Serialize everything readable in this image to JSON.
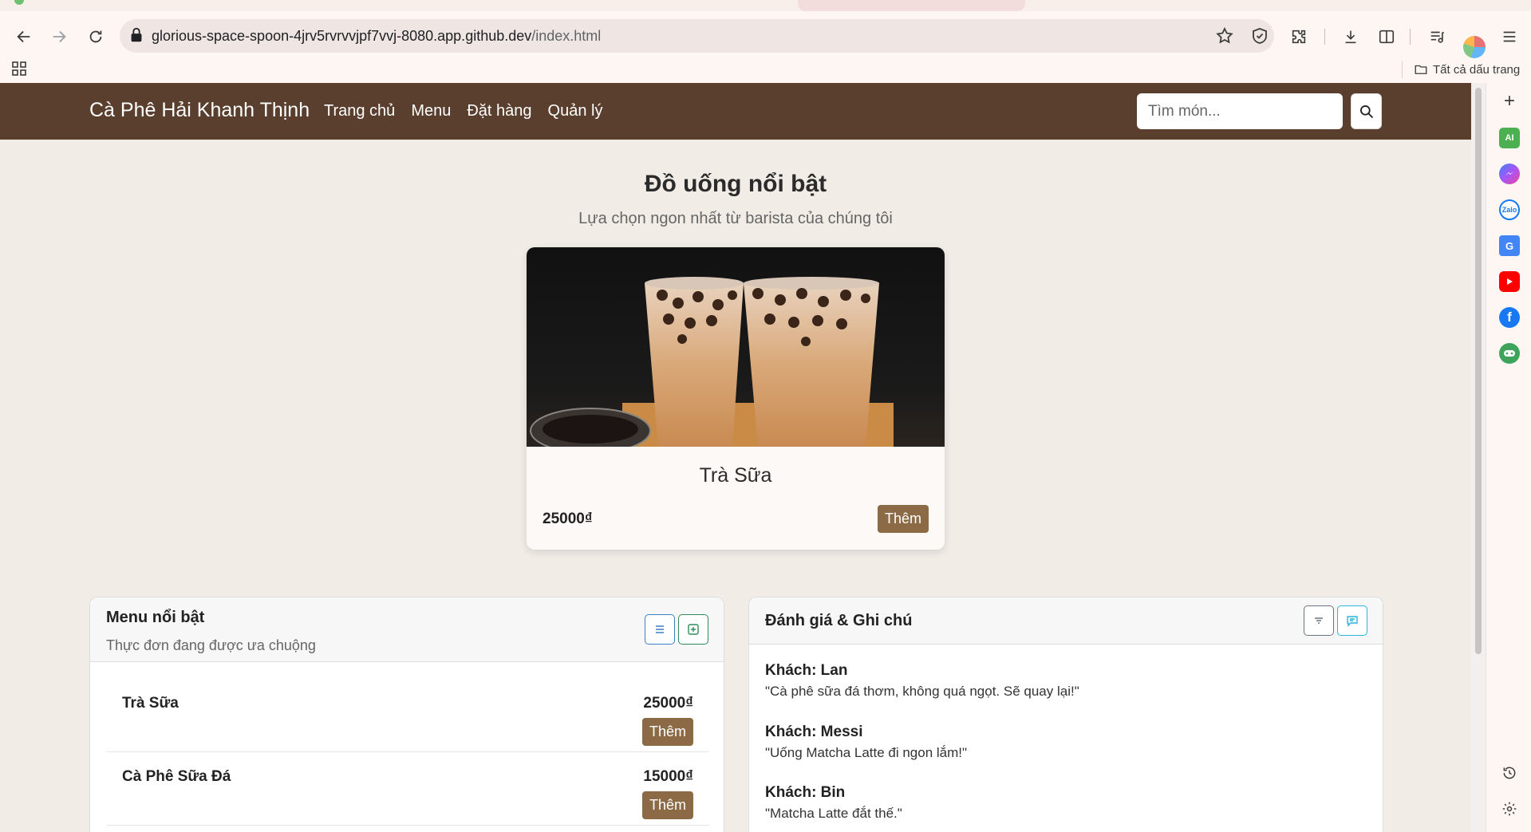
{
  "browser": {
    "url_host": "glorious-space-spoon-4jrv5rvrvvjpf7vvj-8080.app.github.dev",
    "url_path": "/index.html",
    "bookmarks_all_label": "Tất cả dấu trang"
  },
  "site": {
    "brand": "Cà Phê Hải Khanh Thịnh",
    "nav": [
      "Trang chủ",
      "Menu",
      "Đặt hàng",
      "Quản lý"
    ],
    "search_placeholder": "Tìm món..."
  },
  "hero": {
    "title": "Đồ uống nổi bật",
    "subtitle": "Lựa chọn ngon nhất từ barista của chúng tôi",
    "card": {
      "name": "Trà Sữa",
      "price": "25000₫",
      "add_label": "Thêm"
    }
  },
  "menu_panel": {
    "title": "Menu nổi bật",
    "subtitle": "Thực đơn đang được ưa chuộng",
    "items": [
      {
        "name": "Trà Sữa",
        "price": "25000₫",
        "add_label": "Thêm"
      },
      {
        "name": "Cà Phê Sữa Đá",
        "price": "15000₫",
        "add_label": "Thêm"
      }
    ]
  },
  "reviews_panel": {
    "title": "Đánh giá & Ghi chú",
    "reviews": [
      {
        "author": "Khách: Lan",
        "text": "\"Cà phê sữa đá thơm, không quá ngọt. Sẽ quay lại!\""
      },
      {
        "author": "Khách: Messi",
        "text": "\"Uống Matcha Latte đi ngon lắm!\""
      },
      {
        "author": "Khách: Bin",
        "text": "\"Matcha Latte đắt thế.\""
      }
    ]
  },
  "colors": {
    "navbar": "#5a3f2e",
    "button": "#8b6a45",
    "page_bg": "#f1ece6",
    "primary_outline": "#3d7fc4",
    "success_outline": "#2e8b57",
    "info_outline": "#29b6d9"
  },
  "icons": {
    "side_panel": [
      "plus-icon",
      "ai-chat-icon",
      "messenger-icon",
      "zalo-icon",
      "translate-icon",
      "youtube-icon",
      "facebook-icon",
      "game-icon",
      "history-icon",
      "settings-icon"
    ]
  }
}
